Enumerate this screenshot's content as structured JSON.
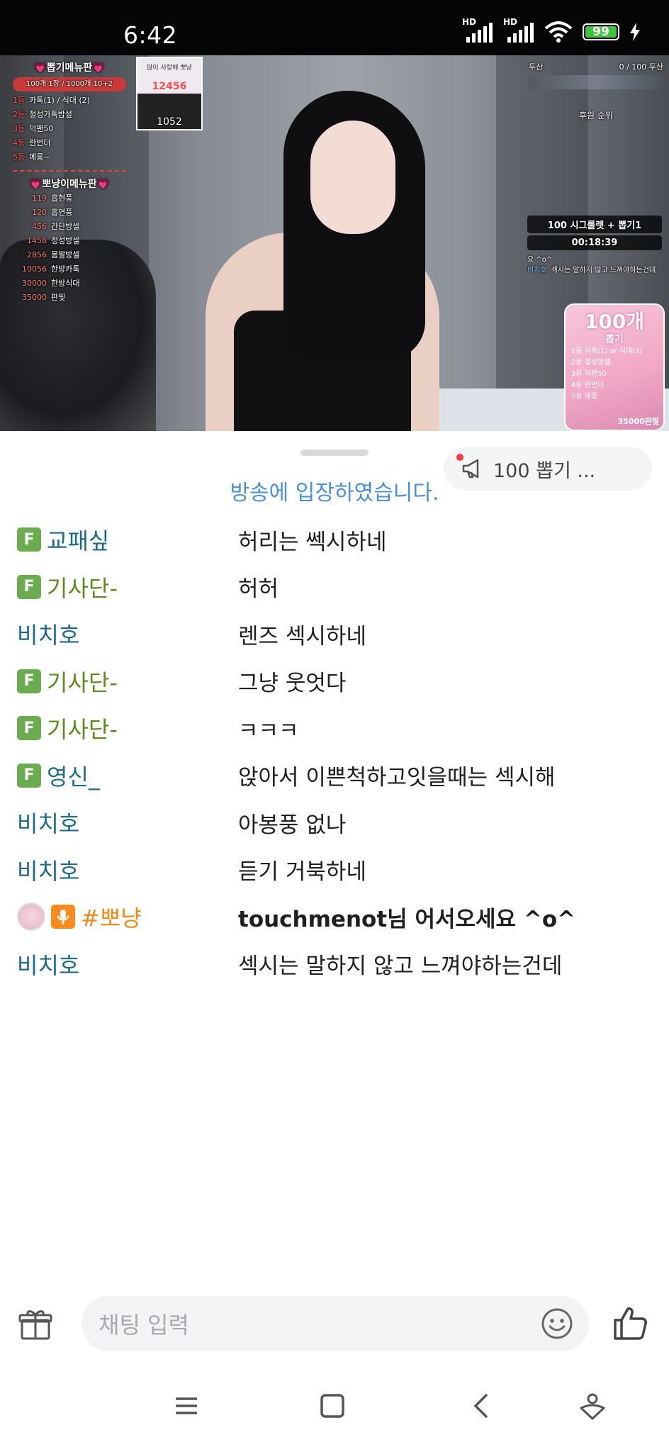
{
  "status_bar": {
    "time": "6:42",
    "network_label": "HD",
    "battery": "99"
  },
  "video_overlay": {
    "menu1": {
      "title": "💗뽑기메뉴판💗",
      "subtitle": "100개 1장 / 1000개 10+2",
      "items": [
        {
          "rank": "1등",
          "label": "카톡(1) / 식대 (2)"
        },
        {
          "rank": "2등",
          "label": "절성가톡밥설"
        },
        {
          "rank": "3등",
          "label": "덕팬50"
        },
        {
          "rank": "4등",
          "label": "란번더"
        },
        {
          "rank": "5등",
          "label": "메롱~"
        }
      ]
    },
    "menu2": {
      "title": "💗뽀냥이메뉴판💗",
      "items": [
        {
          "num": "119",
          "label": "흡현풍"
        },
        {
          "num": "120",
          "label": "흡연풍"
        },
        {
          "num": "456",
          "label": "간단방셀"
        },
        {
          "num": "1456",
          "label": "정성방셀"
        },
        {
          "num": "2856",
          "label": "몸짤방셀"
        },
        {
          "num": "10056",
          "label": "한방카톡"
        },
        {
          "num": "30000",
          "label": "한방식대"
        },
        {
          "num": "35000",
          "label": "판찢"
        }
      ]
    },
    "thumb_count_1": "12456",
    "thumb_count_2": "1052",
    "thumb_caption": "많이 사랑해 뽀냥",
    "goal_left": "두산",
    "goal_right": "0 / 100 두산",
    "donor_ranking": "후원 순위",
    "roulette": "100 시그룰렛 + 뽑기1",
    "timer": "00:18:39",
    "overlay_chat_1": "요 ^o^",
    "overlay_chat_nick": "비치호",
    "overlay_chat_msg": "섹시는 말하지 않고 느껴야하는건데",
    "pink_card": {
      "big": "100개",
      "sub": "뽑기",
      "lines": [
        "1등 카톡(1) or 식대(2)",
        "2등 절성방셀",
        "3등 덕팬50",
        "4등 란번더",
        "5등 메롱"
      ],
      "foot": "35000판찢"
    }
  },
  "notice": {
    "label": "100 뽑기 ..."
  },
  "system_message": "방송에 입장하였습니다.",
  "chat": [
    {
      "badge": "F",
      "nick": "교패싶",
      "nick_color": "#1d6b8c",
      "msg": "허리는 쎅시하네"
    },
    {
      "badge": "F",
      "nick": "기사단-",
      "nick_color": "#5e8a1c",
      "msg": "허허"
    },
    {
      "badge": "",
      "nick": "비치호",
      "nick_color": "#1d6b8c",
      "msg": "렌즈 섹시하네"
    },
    {
      "badge": "F",
      "nick": "기사단-",
      "nick_color": "#5e8a1c",
      "msg": "그냥 웃엇다"
    },
    {
      "badge": "F",
      "nick": "기사단-",
      "nick_color": "#5e8a1c",
      "msg": "ㅋㅋㅋ"
    },
    {
      "badge": "F",
      "nick": "영신_",
      "nick_color": "#1d6b8c",
      "msg": "앉아서  이쁜척하고잇을때는 섹시해"
    },
    {
      "badge": "",
      "nick": "비치호",
      "nick_color": "#1d6b8c",
      "msg": "아봉풍 없나"
    },
    {
      "badge": "",
      "nick": "비치호",
      "nick_color": "#1d6b8c",
      "msg": "듣기 거북하네"
    },
    {
      "badge": "host",
      "nick": "#뽀냥",
      "nick_color": "#f08a1a",
      "msg": "touchmenot님 어서오세요 ^o^",
      "bold": true
    },
    {
      "badge": "",
      "nick": "비치호",
      "nick_color": "#1d6b8c",
      "msg": "섹시는 말하지 않고 느껴야하는건데"
    }
  ],
  "input": {
    "placeholder": "채팅 입력"
  },
  "colors": {
    "system": "#4a90d9",
    "fan_badge": "#6aac4f",
    "host_badge": "#ff8a1e"
  }
}
